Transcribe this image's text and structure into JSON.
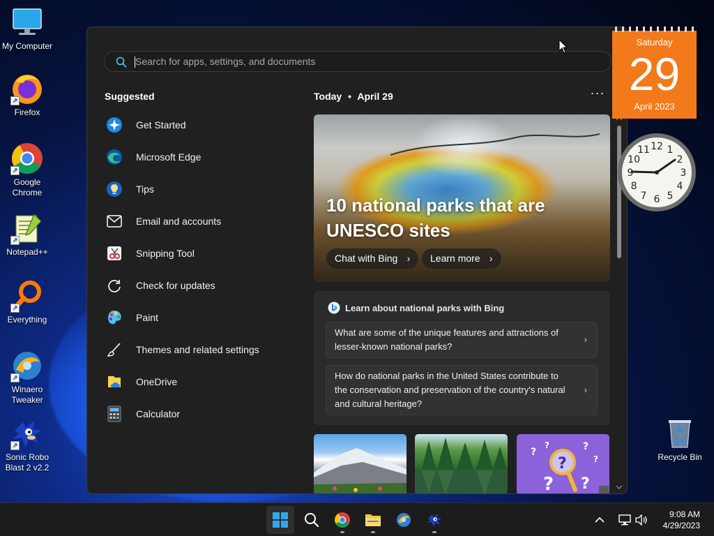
{
  "desktop": {
    "icons": [
      {
        "label": "My Computer",
        "name": "my-computer"
      },
      {
        "label": "Firefox",
        "name": "firefox"
      },
      {
        "label": "Google Chrome",
        "name": "google-chrome"
      },
      {
        "label": "Notepad++",
        "name": "notepad-plus-plus"
      },
      {
        "label": "Everything",
        "name": "everything"
      },
      {
        "label": "Winaero Tweaker",
        "name": "winaero-tweaker"
      },
      {
        "label": "Sonic Robo Blast 2 v2.2",
        "name": "sonic-robo-blast"
      },
      {
        "label": "Recycle Bin",
        "name": "recycle-bin"
      }
    ]
  },
  "start_menu": {
    "search": {
      "placeholder": "Search for apps, settings, and documents",
      "value": ""
    },
    "suggested_title": "Suggested",
    "apps": [
      {
        "label": "Get Started",
        "icon": "get-started-icon"
      },
      {
        "label": "Microsoft Edge",
        "icon": "edge-icon"
      },
      {
        "label": "Tips",
        "icon": "tips-icon"
      },
      {
        "label": "Email and accounts",
        "icon": "mail-icon"
      },
      {
        "label": "Snipping Tool",
        "icon": "snipping-tool-icon"
      },
      {
        "label": "Check for updates",
        "icon": "refresh-icon"
      },
      {
        "label": "Paint",
        "icon": "paint-icon"
      },
      {
        "label": "Themes and related settings",
        "icon": "brush-icon"
      },
      {
        "label": "OneDrive",
        "icon": "onedrive-icon"
      },
      {
        "label": "Calculator",
        "icon": "calculator-icon"
      }
    ],
    "feed": {
      "today": "Today",
      "separator": "•",
      "date": "April 29",
      "more": "···",
      "hero": {
        "title": "10 national parks that are UNESCO sites",
        "chat_button": "Chat with Bing",
        "learn_button": "Learn more"
      },
      "bing_card": {
        "title": "Learn about national parks with Bing",
        "questions": [
          "What are some of the unique features and attractions of lesser-known national parks?",
          "How do national parks in the United States contribute to the conservation and preservation of the country's natural and cultural heritage?"
        ]
      }
    }
  },
  "gadgets": {
    "calendar": {
      "weekday": "Saturday",
      "day": "29",
      "month_year": "April 2023"
    },
    "clock": {
      "numerals": [
        "12",
        "1",
        "2",
        "3",
        "4",
        "5",
        "6",
        "7",
        "8",
        "9",
        "10",
        "11"
      ]
    }
  },
  "taskbar": {
    "time": "9:08 AM",
    "date": "4/29/2023"
  },
  "colors": {
    "accent": "#4cc2ff",
    "calendar_orange": "#f27a1a",
    "panel_bg": "#202020",
    "taskbar_bg": "#1c1c1c"
  }
}
